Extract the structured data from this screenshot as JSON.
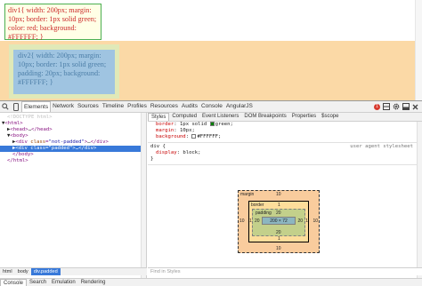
{
  "page": {
    "div1_text": [
      "div1{ width: 200px; margin:",
      "10px; border: 1px solid green;",
      "color: red; background:",
      "#FFFFFF; }"
    ],
    "div2_text": [
      "div2{ width: 200px; margin:",
      "10px; border: 1px solid green;",
      "padding: 20px; background:",
      "#FFFFFF; }"
    ]
  },
  "toolbar": {
    "tabs": [
      "Elements",
      "Network",
      "Sources",
      "Timeline",
      "Profiles",
      "Resources",
      "Audits",
      "Console",
      "AngularJS"
    ],
    "active_tab": "Elements",
    "icons": [
      "search-icon",
      "device-mode-icon"
    ],
    "right_icons": [
      "error-badge",
      "gear-icon",
      "dock-icon",
      "close-icon"
    ],
    "error_count": "1"
  },
  "elements": {
    "lines": [
      {
        "indent": 1,
        "text": "<!DOCTYPE html>",
        "kind": "doctype"
      },
      {
        "indent": 0,
        "arrow": "▼",
        "open": "html"
      },
      {
        "indent": 1,
        "arrow": "▶",
        "open": "head",
        "close": "head",
        "ellipsis": "…"
      },
      {
        "indent": 1,
        "arrow": "▼",
        "open": "body"
      },
      {
        "indent": 2,
        "arrow": "▶",
        "open": "div",
        "attr": "class",
        "value": "\"not-padded\"",
        "close": "div",
        "ellipsis": "…"
      },
      {
        "indent": 2,
        "arrow": "▶",
        "open": "div",
        "attr": "class",
        "value": "\"padded\"",
        "close": "div",
        "ellipsis": "…",
        "selected": true
      },
      {
        "indent": 1,
        "close_only": "body"
      },
      {
        "indent": 0,
        "close_only": "html"
      }
    ]
  },
  "breadcrumbs": [
    "html",
    "body",
    "div.padded"
  ],
  "styles": {
    "tabs": [
      "Styles",
      "Computed",
      "Event Listeners",
      "DOM Breakpoints",
      "Properties",
      "$scope"
    ],
    "active_tab": "Styles",
    "rule1": [
      {
        "prop": "border",
        "val": "1px solid",
        "swatch": "#008000",
        "val2": "green;"
      },
      {
        "prop": "margin",
        "val": "10px;"
      },
      {
        "prop": "background",
        "val": "",
        "swatch": "#FFFFFF",
        "val2": "#FFFFFF;"
      }
    ],
    "rule2_selector": "div {",
    "rule2_origin": "user agent stylesheet",
    "rule2_props": [
      {
        "prop": "display",
        "val": "block;"
      }
    ],
    "rule2_close": "}",
    "find_placeholder": "Find in Styles"
  },
  "box_model": {
    "margin_label": "margin",
    "margin_top": "10",
    "margin_right": "10",
    "margin_bottom": "10",
    "margin_left": "10",
    "border_label": "border",
    "border_top": "1",
    "border_right": "1",
    "border_bottom": "1",
    "border_left": "1",
    "padding_label": "padding",
    "padding_top": "20",
    "padding_right": "20",
    "padding_bottom": "20",
    "padding_left": "20",
    "content": "200 × 72"
  },
  "drawer": {
    "tabs": [
      "Console",
      "Search",
      "Emulation",
      "Rendering"
    ],
    "active_tab": "Console"
  },
  "colors": {
    "selection": "#3879d9",
    "margin_bg": "#f9cc9d",
    "border_bg": "#fddd9b",
    "padding_bg": "#c3d08b",
    "content_bg": "#8cb6c0"
  }
}
